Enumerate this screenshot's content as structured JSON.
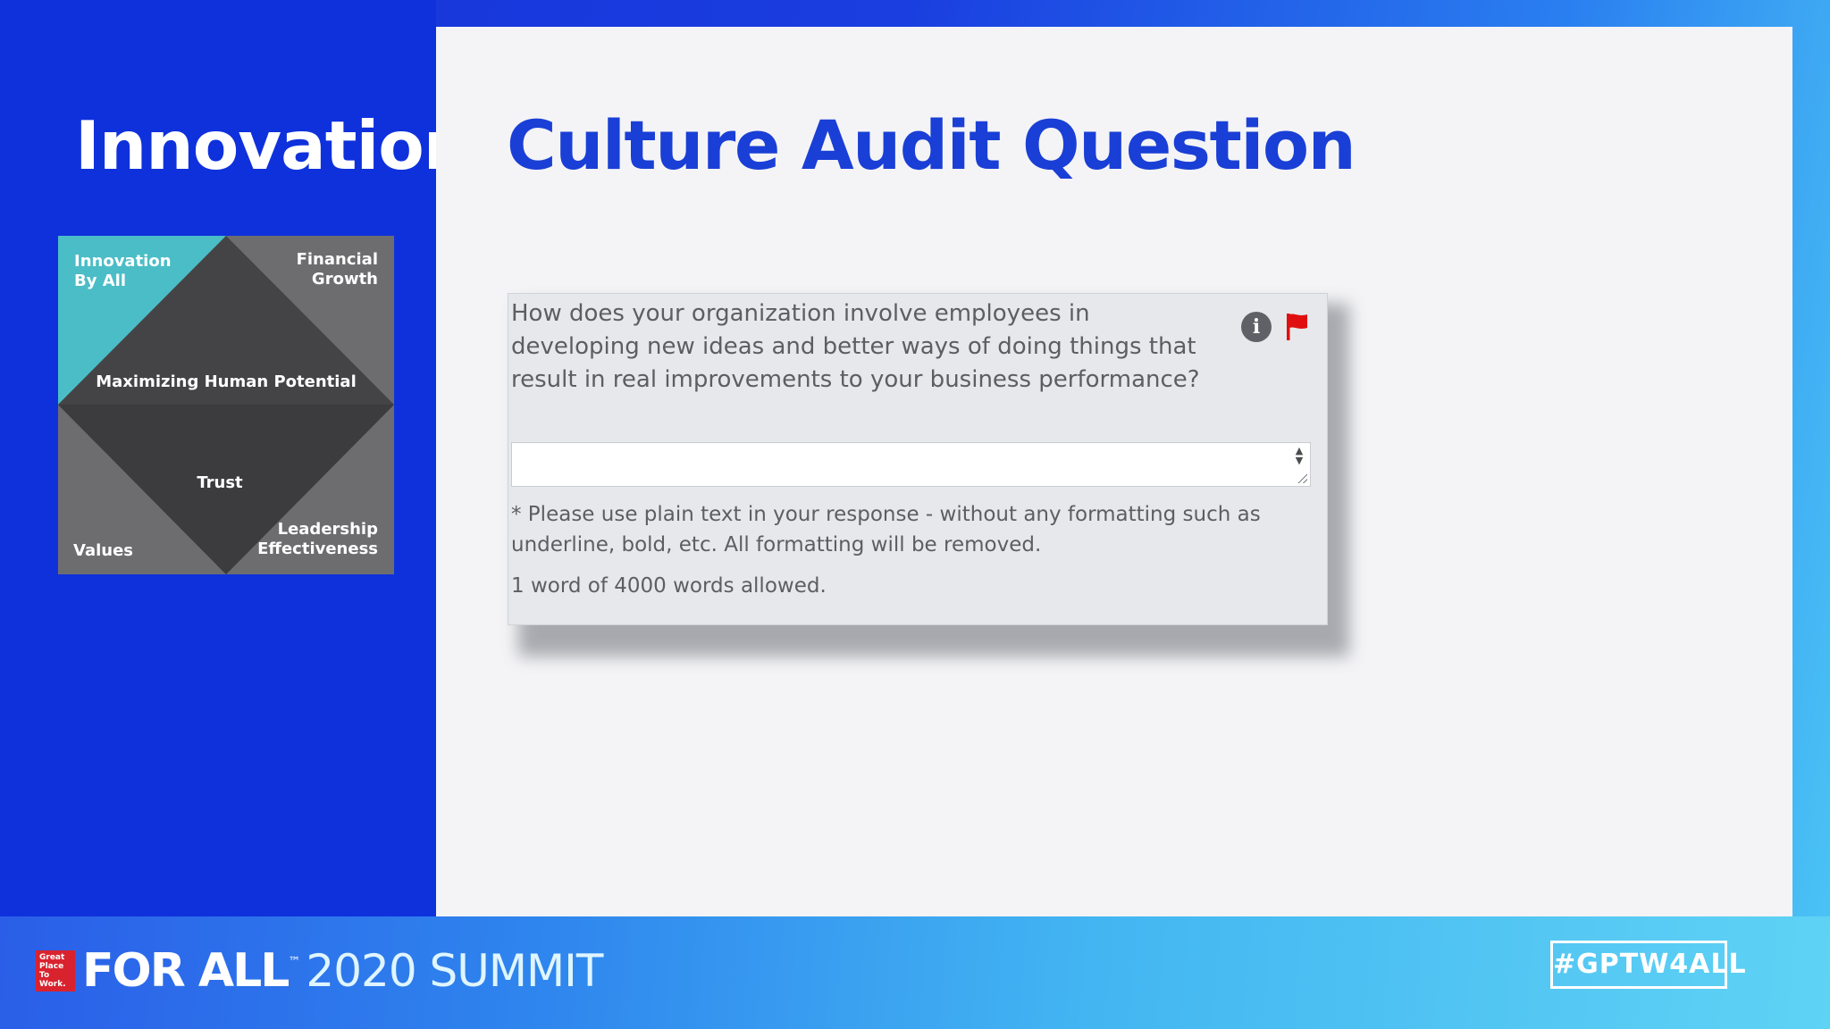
{
  "slide": {
    "left_title": "Innovation",
    "title": "Culture Audit Question"
  },
  "model_diagram": {
    "labels": {
      "top_left": [
        "Innovation",
        "By All"
      ],
      "top_right": [
        "Financial",
        "Growth"
      ],
      "center": "Maximizing Human Potential",
      "inner": "Trust",
      "bottom_left": "Values",
      "bottom_right": [
        "Leadership",
        "Effectiveness"
      ]
    },
    "colors": {
      "highlight": "#4bbdc6",
      "dark": "#444447",
      "mid": "#6d6d70"
    }
  },
  "question_card": {
    "question": "How does your organization involve employees in developing new ideas and better ways of doing things that result in real improvements to your business performance?",
    "response_value": "",
    "note": "* Please use plain text in your response - without any formatting such as underline, bold, etc. All formatting will be removed.",
    "word_count": "1 word of 4000 words allowed.",
    "icons": {
      "info": "info-icon",
      "flag": "flag-icon",
      "flag_color": "#e01010"
    }
  },
  "footer": {
    "logo_text": [
      "Great",
      "Place",
      "To",
      "Work."
    ],
    "brand_main": "FOR ALL",
    "brand_tm": "™",
    "brand_event": "2020 SUMMIT",
    "hashtag": "#GPTW4ALL"
  }
}
